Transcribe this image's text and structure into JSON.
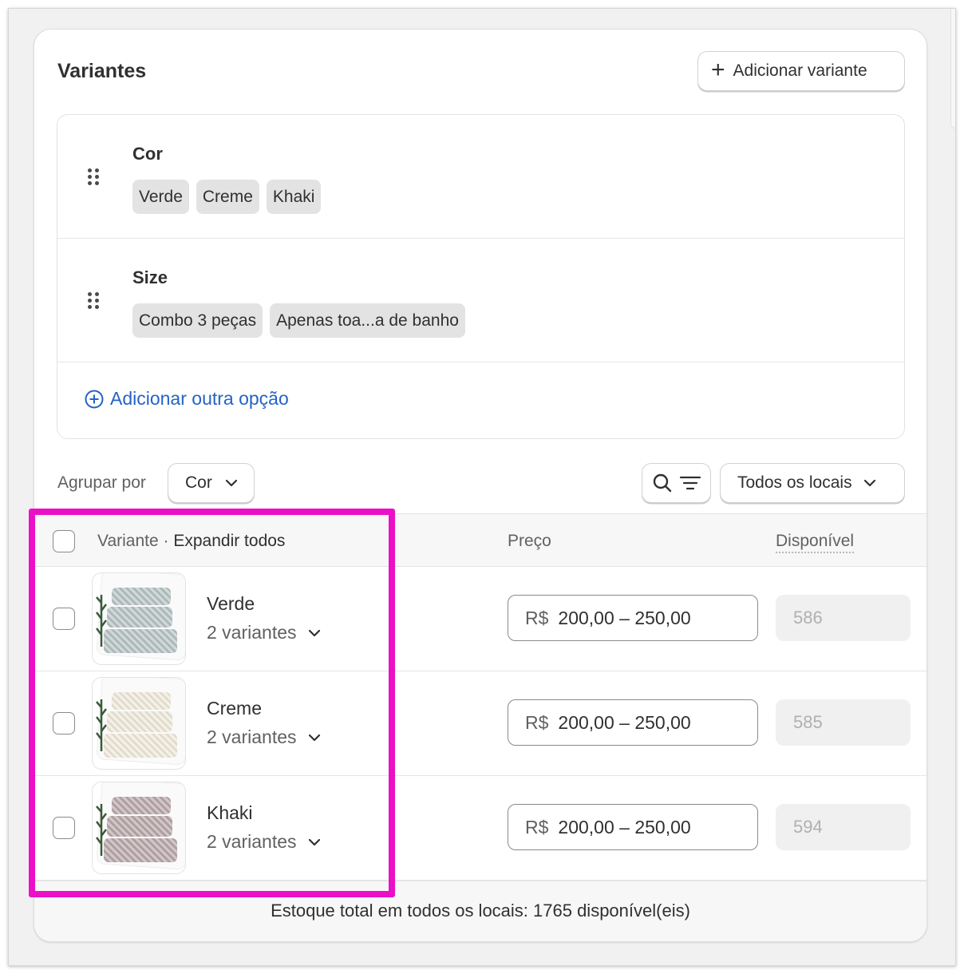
{
  "card": {
    "title": "Variantes",
    "add_variant_label": "Adicionar variante"
  },
  "options": [
    {
      "name": "Cor",
      "values": [
        "Verde",
        "Creme",
        "Khaki"
      ]
    },
    {
      "name": "Size",
      "values": [
        "Combo 3 peças",
        "Apenas toa...a de banho"
      ]
    }
  ],
  "add_option_label": "Adicionar outra opção",
  "controls": {
    "group_by_label": "Agrupar por",
    "group_by_value": "Cor",
    "locations_value": "Todos os locais"
  },
  "table": {
    "head_variant": "Variante",
    "head_separator": " · ",
    "head_expand": "Expandir todos",
    "head_price": "Preço",
    "head_available": "Disponível",
    "rows": [
      {
        "name": "Verde",
        "variant_count": "2 variantes",
        "currency": "R$",
        "price": "200,00 – 250,00",
        "available": "586",
        "towel_color": "#b7c3c4"
      },
      {
        "name": "Creme",
        "variant_count": "2 variantes",
        "currency": "R$",
        "price": "200,00 – 250,00",
        "available": "585",
        "towel_color": "#efe9da"
      },
      {
        "name": "Khaki",
        "variant_count": "2 variantes",
        "currency": "R$",
        "price": "200,00 – 250,00",
        "available": "594",
        "towel_color": "#b9a8aa"
      }
    ]
  },
  "footer": {
    "total_stock_text": "Estoque total em todos os locais: 1765 disponível(eis)"
  },
  "colors": {
    "highlight": "#ec0fc8",
    "link": "#2563c4"
  }
}
